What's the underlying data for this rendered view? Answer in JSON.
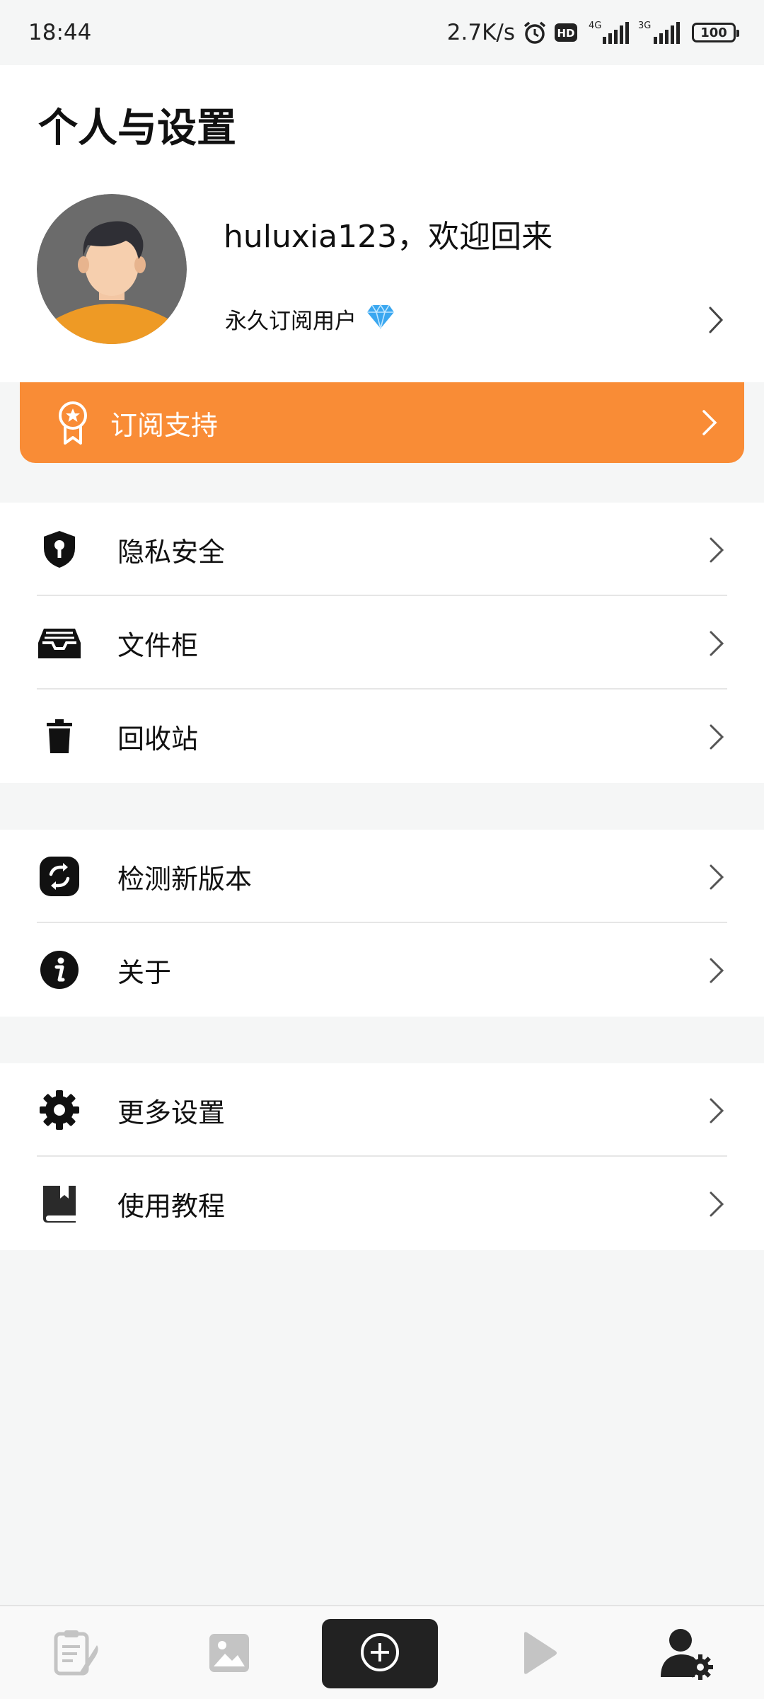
{
  "status_bar": {
    "time": "18:44",
    "network_speed": "2.7K/s",
    "hd_badge": "HD",
    "signal1_label": "4G",
    "signal2_label": "3G",
    "battery": "100",
    "icons": [
      "alarm-icon",
      "hd-icon",
      "signal-icon",
      "battery-icon"
    ]
  },
  "header": {
    "title": "个人与设置"
  },
  "profile": {
    "greeting": "huluxia123，欢迎回来",
    "subscription": "永久订阅用户",
    "badge_icon": "diamond-icon"
  },
  "subscribe_banner": {
    "label": "订阅支持",
    "icon": "ribbon-award-icon",
    "color": "#f98c36"
  },
  "groups": [
    {
      "items": [
        {
          "label": "隐私安全",
          "icon": "shield-key-icon"
        },
        {
          "label": "文件柜",
          "icon": "inbox-tray-icon"
        },
        {
          "label": "回收站",
          "icon": "trash-icon"
        }
      ]
    },
    {
      "items": [
        {
          "label": "检测新版本",
          "icon": "refresh-icon"
        },
        {
          "label": "关于",
          "icon": "info-icon"
        }
      ]
    },
    {
      "items": [
        {
          "label": "更多设置",
          "icon": "gear-icon"
        },
        {
          "label": "使用教程",
          "icon": "bookmark-book-icon"
        }
      ]
    }
  ],
  "bottom_nav": {
    "items": [
      {
        "name": "notes",
        "icon": "notes-pen-icon",
        "active": false
      },
      {
        "name": "gallery",
        "icon": "image-icon",
        "active": false
      },
      {
        "name": "add",
        "icon": "add-circle-icon",
        "active": false
      },
      {
        "name": "play",
        "icon": "play-icon",
        "active": false
      },
      {
        "name": "profile-settings",
        "icon": "user-gear-icon",
        "active": true
      }
    ]
  }
}
